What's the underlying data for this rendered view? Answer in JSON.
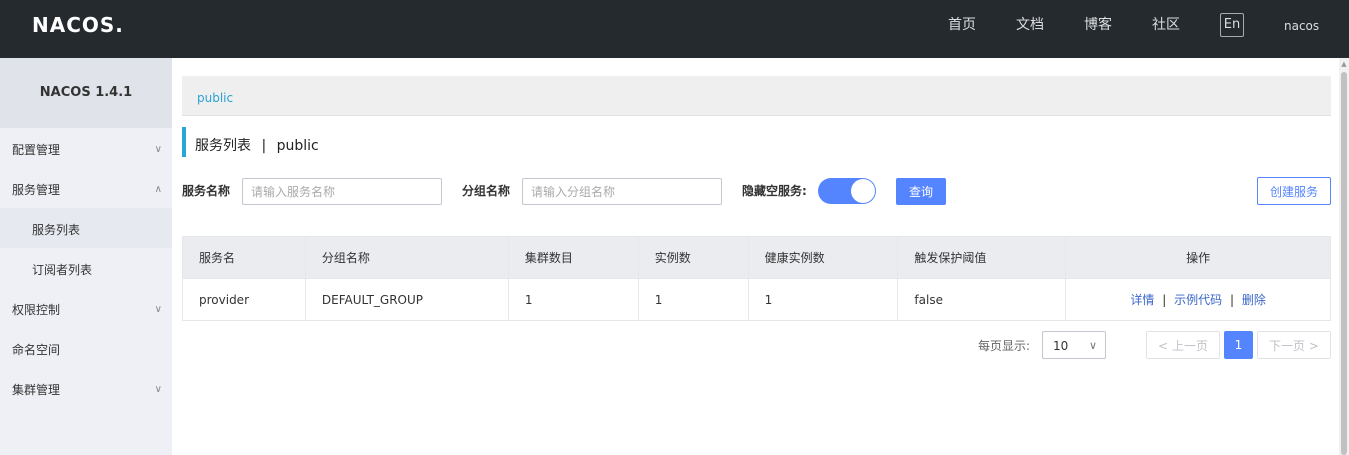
{
  "header": {
    "logo": "NACOS.",
    "nav": [
      "首页",
      "文档",
      "博客",
      "社区"
    ],
    "lang_button": "En",
    "user": "nacos"
  },
  "sidebar": {
    "title": "NACOS 1.4.1",
    "items": [
      {
        "label": "配置管理",
        "chevron": "∨"
      },
      {
        "label": "服务管理",
        "chevron": "∧"
      },
      {
        "label": "服务列表"
      },
      {
        "label": "订阅者列表"
      },
      {
        "label": "权限控制",
        "chevron": "∨"
      },
      {
        "label": "命名空间"
      },
      {
        "label": "集群管理",
        "chevron": "∨"
      }
    ]
  },
  "namespace_bar": {
    "current": "public"
  },
  "page": {
    "title": "服务列表",
    "separator": "|",
    "namespace": "public"
  },
  "filters": {
    "service_name_label": "服务名称",
    "service_name_placeholder": "请输入服务名称",
    "group_name_label": "分组名称",
    "group_name_placeholder": "请输入分组名称",
    "hide_empty_label": "隐藏空服务:",
    "hide_empty_on": true,
    "query_button": "查询",
    "create_button": "创建服务"
  },
  "table": {
    "headers": [
      "服务名",
      "分组名称",
      "集群数目",
      "实例数",
      "健康实例数",
      "触发保护阈值",
      "操作"
    ],
    "rows": [
      {
        "service": "provider",
        "group": "DEFAULT_GROUP",
        "clusters": "1",
        "instances": "1",
        "healthy": "1",
        "threshold": "false",
        "actions": [
          "详情",
          "示例代码",
          "删除"
        ]
      }
    ],
    "action_separator": "|"
  },
  "pagination": {
    "page_size_label": "每页显示:",
    "page_size": "10",
    "prev": "上一页",
    "current": "1",
    "next": "下一页"
  },
  "colors": {
    "header_bg": "#252a2f",
    "primary": "#5584ff",
    "accent_bar": "#2aa5d8",
    "link": "#3a66c8"
  }
}
